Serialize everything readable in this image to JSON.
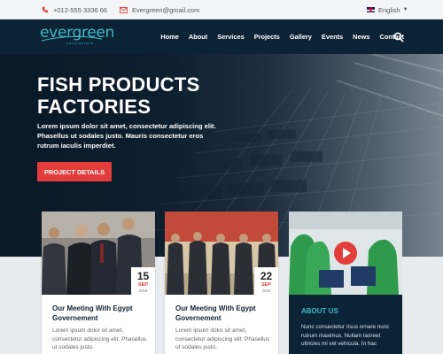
{
  "topbar": {
    "phone": "+012-555 3336 66",
    "email": "Evergreen@gmail.com",
    "language": "English"
  },
  "brand": {
    "name": "evergreen",
    "tagline": "contractors"
  },
  "nav": {
    "items": [
      "Home",
      "About",
      "Services",
      "Projects",
      "Gallery",
      "Events",
      "News",
      "Contact"
    ]
  },
  "hero": {
    "title_line1": "FISH PRODUCTS",
    "title_line2": "FACTORIES",
    "body": "Lorem ipsum dolor sit amet, consectetur adipiscing elit. Phasellus ut sodales justo. Mauris consectetur eros rutrum iaculis imperdiet.",
    "button": "PROJECT DETAILS"
  },
  "cards": [
    {
      "day": "15",
      "month": "SEP",
      "year": "2018",
      "title": "Our Meeting With Egypt Governement",
      "text": "Lorem ipsum dolor sit amet, consectetur adipiscing elit. Phasellus ut sodales justo."
    },
    {
      "day": "22",
      "month": "SEP",
      "year": "2018",
      "title": "Our Meeting With Egypt Governement",
      "text": "Lorem ipsum dolor sit amet, consectetur adipiscing elit. Phasellus ut sodales justo."
    }
  ],
  "about": {
    "title": "ABOUT US",
    "text": "Nunc consectetur risus ornare nunc rutrum maximus. Nullam laoreet ultricies mi vel vehicula. In hac"
  },
  "colors": {
    "navy": "#0c2336",
    "accent_red": "#e23d3a",
    "teal": "#3cb9c4"
  }
}
